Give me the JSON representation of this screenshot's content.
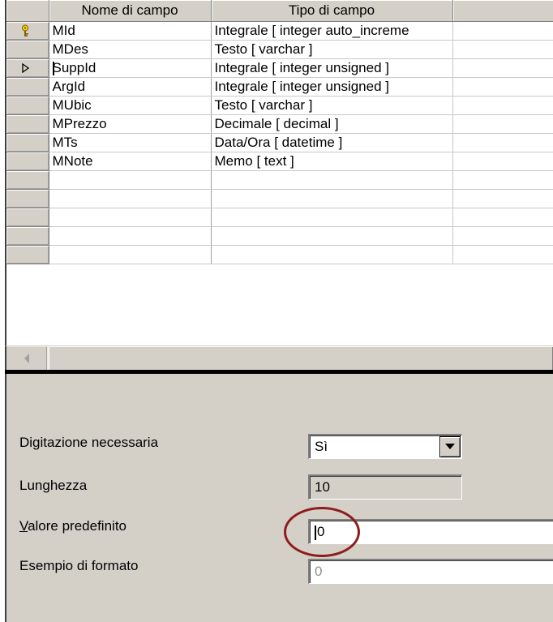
{
  "grid": {
    "columns": [
      "Nome di campo",
      "Tipo di campo",
      ""
    ],
    "rows": [
      {
        "name": "MId",
        "type": "Integrale [ integer auto_increme",
        "icon": "primary-key"
      },
      {
        "name": "MDes",
        "type": "Testo [ varchar ]",
        "icon": ""
      },
      {
        "name": "SuppId",
        "type": "Integrale [ integer unsigned ]",
        "icon": "current-row"
      },
      {
        "name": "ArgId",
        "type": "Integrale [ integer unsigned ]",
        "icon": ""
      },
      {
        "name": "MUbic",
        "type": "Testo [ varchar ]",
        "icon": ""
      },
      {
        "name": "MPrezzo",
        "type": "Decimale [ decimal ]",
        "icon": ""
      },
      {
        "name": "MTs",
        "type": "Data/Ora [ datetime ]",
        "icon": ""
      },
      {
        "name": "MNote",
        "type": "Memo [ text ]",
        "icon": ""
      },
      {
        "name": "",
        "type": "",
        "icon": ""
      },
      {
        "name": "",
        "type": "",
        "icon": ""
      },
      {
        "name": "",
        "type": "",
        "icon": ""
      },
      {
        "name": "",
        "type": "",
        "icon": ""
      },
      {
        "name": "",
        "type": "",
        "icon": ""
      }
    ]
  },
  "properties": {
    "required": {
      "label": "Digitazione necessaria",
      "value": "Sì"
    },
    "length": {
      "label": "Lunghezza",
      "value": "10"
    },
    "default": {
      "label_rest": "alore predefinito",
      "label_access_key": "V",
      "value": "0"
    },
    "format_example": {
      "label": "Esempio di formato",
      "value": "0"
    }
  },
  "colors": {
    "annotation_ring": "#8e1c1c",
    "panel": "#d4d0c8"
  }
}
